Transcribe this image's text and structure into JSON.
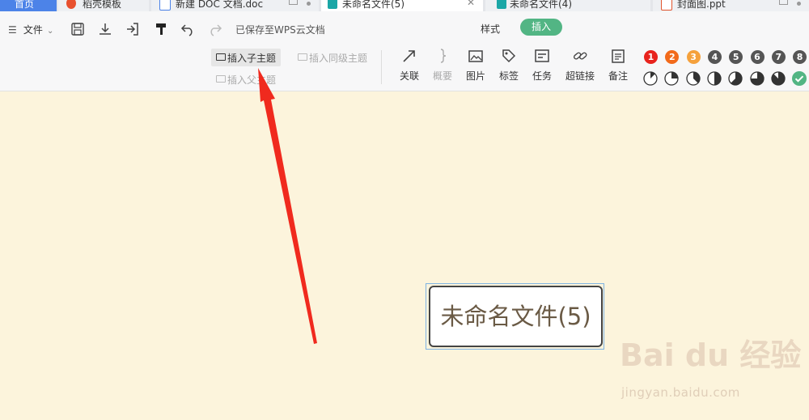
{
  "tabs": [
    {
      "label": "首页"
    },
    {
      "label": "稻壳模板"
    },
    {
      "label": "新建 DOC 文档.doc"
    },
    {
      "label": "未命名文件(5)"
    },
    {
      "label": "未命名文件(4)"
    },
    {
      "label": "封面图.ppt"
    }
  ],
  "toolbar": {
    "file_menu": "文件",
    "save_status": "已保存至WPS云文档",
    "mode_tabs": {
      "style": "样式",
      "insert": "插入"
    },
    "insert_child": "插入子主题",
    "insert_sibling": "插入同级主题",
    "insert_parent": "插入父主题",
    "tools": [
      {
        "label": "关联",
        "icon": "relation-arrow-icon"
      },
      {
        "label": "概要",
        "icon": "summary-brace-icon"
      },
      {
        "label": "图片",
        "icon": "image-icon"
      },
      {
        "label": "标签",
        "icon": "tag-icon"
      },
      {
        "label": "任务",
        "icon": "task-icon"
      },
      {
        "label": "超链接",
        "icon": "link-icon"
      },
      {
        "label": "备注",
        "icon": "note-icon"
      }
    ],
    "priority_numbers": [
      "1",
      "2",
      "3",
      "4",
      "5",
      "6",
      "7",
      "8"
    ],
    "priority_colors": [
      "#e8231d",
      "#f26a1b",
      "#f5a13c",
      "#555555",
      "#555555",
      "#555555",
      "#555555",
      "#555555"
    ],
    "progress_levels": [
      0.125,
      0.25,
      0.375,
      0.5,
      0.625,
      0.75,
      0.875,
      1.0
    ]
  },
  "canvas": {
    "node_text": "未命名文件(5)",
    "background": "#fcf4dc",
    "annotation_color": "#f02a1e"
  },
  "watermark": {
    "logo": "Bai du 经验",
    "url": "jingyan.baidu.com"
  },
  "colors": {
    "accent_green": "#52b584",
    "home_tab_blue": "#4c83e8"
  }
}
